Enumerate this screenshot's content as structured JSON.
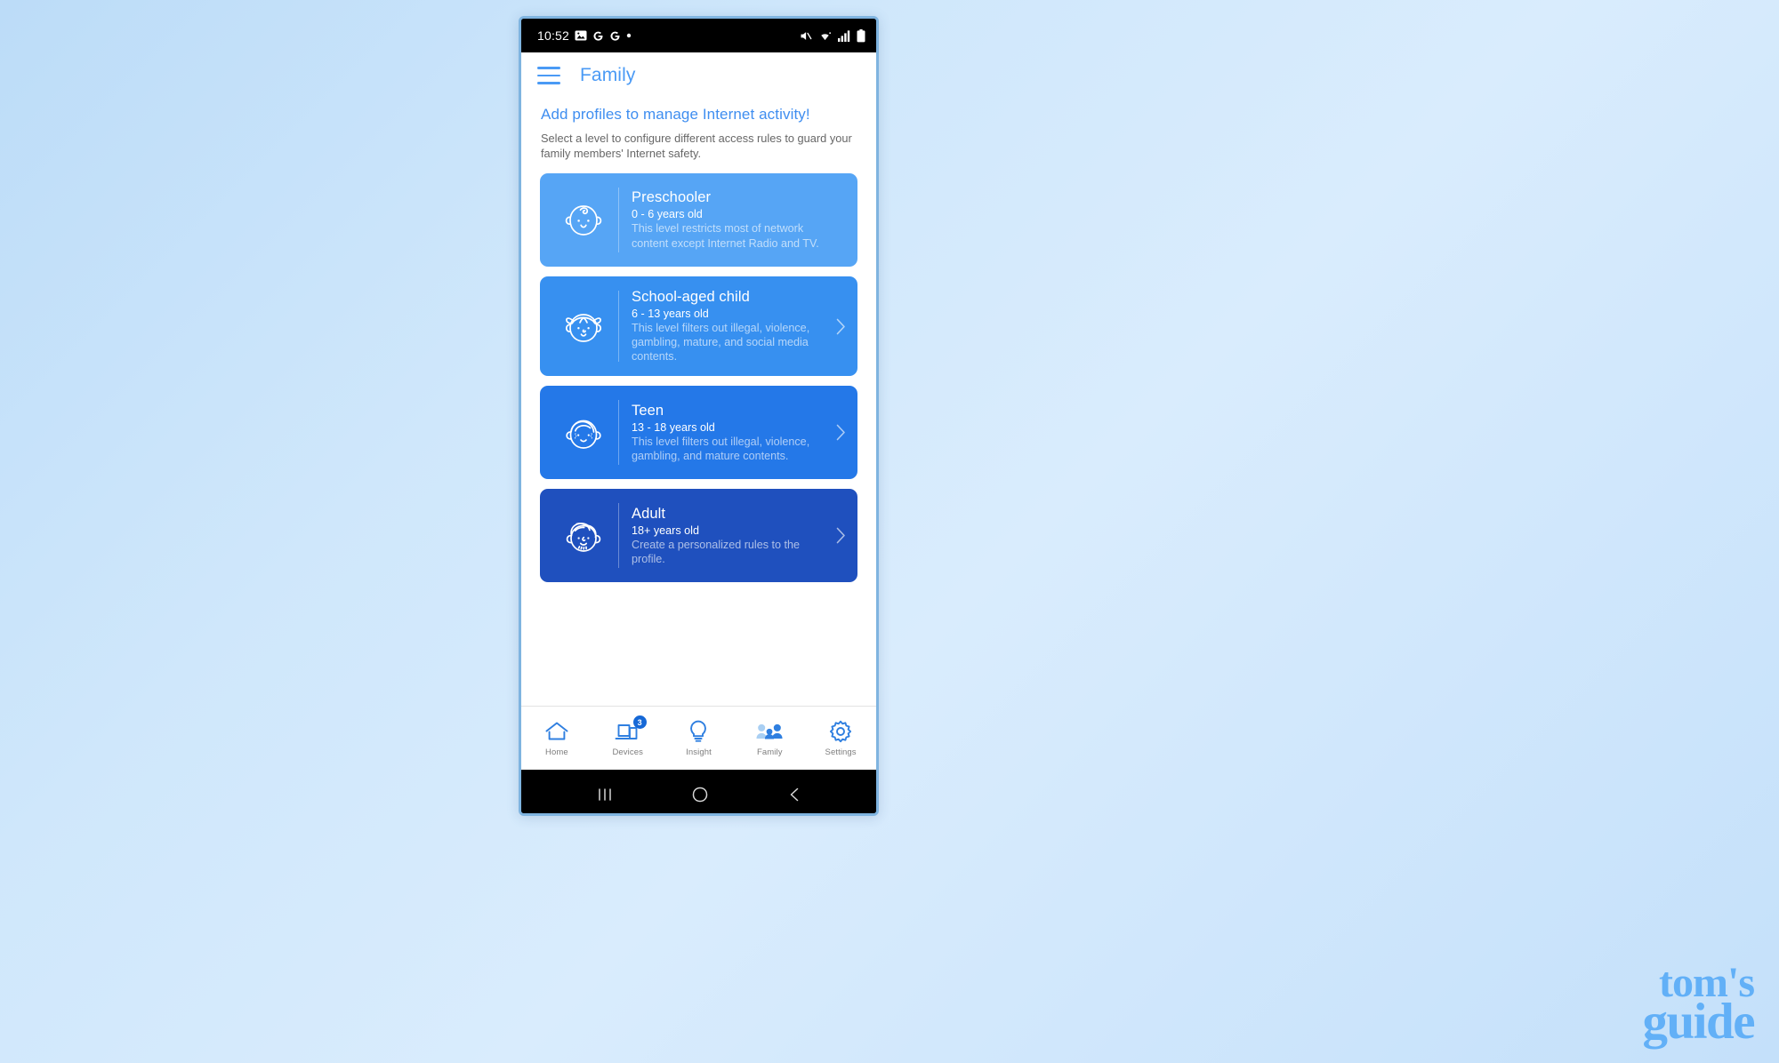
{
  "status_bar": {
    "time": "10:52",
    "left_icons": [
      "image-icon",
      "google-icon",
      "google-icon",
      "dot-icon"
    ],
    "right_icons": [
      "mute-icon",
      "wifi-icon",
      "cellular-signal-icon",
      "battery-icon"
    ]
  },
  "app_bar": {
    "menu_label": "menu",
    "title": "Family"
  },
  "intro": {
    "heading": "Add profiles to manage Internet activity!",
    "subtext": "Select a level to configure different access rules to guard your family members' Internet safety."
  },
  "profiles": [
    {
      "name": "Preschooler",
      "age": "0 - 6 years old",
      "description": "This level restricts most of network content except Internet Radio and TV.",
      "color": "#56a5f5",
      "icon": "baby-face-icon",
      "has_chevron": false
    },
    {
      "name": "School-aged child",
      "age": "6 - 13 years old",
      "description": "This level filters out illegal, violence, gambling, mature, and social media contents.",
      "color": "#3790f0",
      "icon": "child-face-icon",
      "has_chevron": true
    },
    {
      "name": "Teen",
      "age": "13 - 18 years old",
      "description": "This level filters out illegal, violence, gambling, and mature contents.",
      "color": "#2478e8",
      "icon": "teen-face-icon",
      "has_chevron": true
    },
    {
      "name": "Adult",
      "age": "18+ years old",
      "description": "Create a personalized rules to the profile.",
      "color": "#1f50be",
      "icon": "adult-face-icon",
      "has_chevron": true
    }
  ],
  "tabs": [
    {
      "label": "Home",
      "icon": "home-icon",
      "badge": "",
      "active": false
    },
    {
      "label": "Devices",
      "icon": "devices-icon",
      "badge": "3",
      "active": false
    },
    {
      "label": "Insight",
      "icon": "lightbulb-icon",
      "badge": "",
      "active": false
    },
    {
      "label": "Family",
      "icon": "family-group-icon",
      "badge": "",
      "active": true
    },
    {
      "label": "Settings",
      "icon": "gear-icon",
      "badge": "",
      "active": false
    }
  ],
  "nav_bar": {
    "recents": "recents-icon",
    "home": "home-circle-icon",
    "back": "back-chevron-icon"
  },
  "watermark": {
    "line1": "tom's",
    "line2": "guide",
    "color": "#62b0f7"
  },
  "theme": {
    "accent": "#4a9af5",
    "heading": "#3f8ef0",
    "badge": "#1668d6"
  }
}
